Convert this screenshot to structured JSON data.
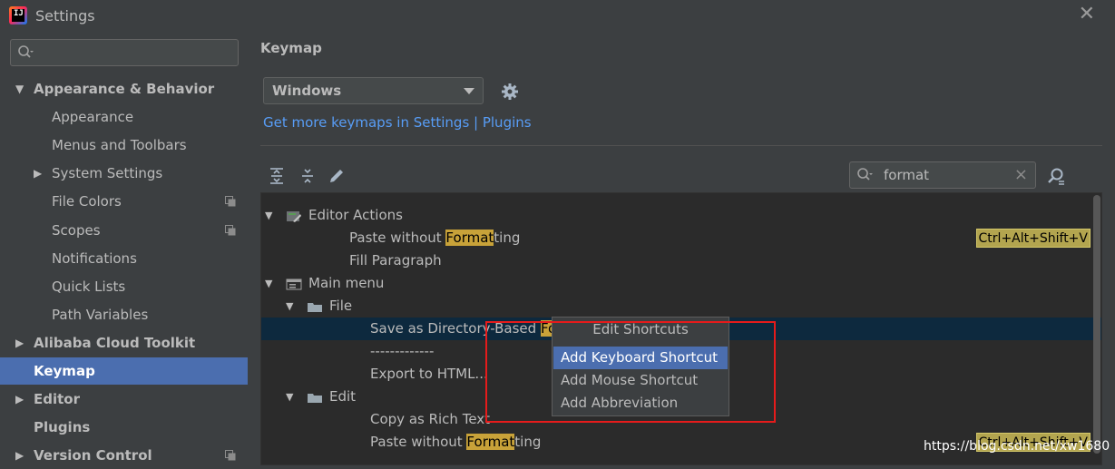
{
  "window": {
    "title": "Settings",
    "app_icon_text": "IJ"
  },
  "sidebar": {
    "search_placeholder": "",
    "items": [
      {
        "label": "Appearance & Behavior",
        "level": 0,
        "expanded": true,
        "bold": true
      },
      {
        "label": "Appearance",
        "level": 1
      },
      {
        "label": "Menus and Toolbars",
        "level": 1
      },
      {
        "label": "System Settings",
        "level": 1,
        "expanded": false
      },
      {
        "label": "File Colors",
        "level": 1,
        "copy_icon": true
      },
      {
        "label": "Scopes",
        "level": 1,
        "copy_icon": true
      },
      {
        "label": "Notifications",
        "level": 1
      },
      {
        "label": "Quick Lists",
        "level": 1
      },
      {
        "label": "Path Variables",
        "level": 1
      },
      {
        "label": "Alibaba Cloud Toolkit",
        "level": 0,
        "expanded": false,
        "bold": true
      },
      {
        "label": "Keymap",
        "level": 0,
        "bold": true,
        "selected": true
      },
      {
        "label": "Editor",
        "level": 0,
        "expanded": false,
        "bold": true
      },
      {
        "label": "Plugins",
        "level": 0,
        "bold": true
      },
      {
        "label": "Version Control",
        "level": 0,
        "expanded": false,
        "bold": true,
        "copy_icon": true
      }
    ]
  },
  "main": {
    "heading": "Keymap",
    "keymap_select": {
      "value": "Windows"
    },
    "link": "Get more keymaps in Settings | Plugins",
    "filter": {
      "value": "format"
    },
    "tree": [
      {
        "pre": "Editor Actions",
        "level": 0,
        "expander": "open",
        "icon": "editor-actions-icon"
      },
      {
        "pre": "Paste without ",
        "hl": "Format",
        "post": "ting",
        "level": 1,
        "shortcut": "Ctrl+Alt+Shift+V"
      },
      {
        "pre": "Fill Paragraph",
        "level": 1
      },
      {
        "pre": "Main menu",
        "level": 0,
        "expander": "open",
        "icon": "menu-icon"
      },
      {
        "pre": "File",
        "level": 1,
        "expander": "open",
        "icon": "folder-icon"
      },
      {
        "pre": "Save as Directory-Based ",
        "hl": "Format",
        "level": 2,
        "selected": true
      },
      {
        "pre": "-------------",
        "level": 2
      },
      {
        "pre": "Export to HTML...",
        "level": 2
      },
      {
        "pre": "Edit",
        "level": 1,
        "expander": "open",
        "icon": "folder-icon"
      },
      {
        "pre": "Copy as Rich Text",
        "level": 2
      },
      {
        "pre": "Paste without ",
        "hl": "Format",
        "post": "ting",
        "level": 2,
        "shortcut": "Ctrl+Alt+Shift+V"
      },
      {
        "pre": "-------------",
        "level": 2
      }
    ]
  },
  "popup": {
    "title": "Edit Shortcuts",
    "items": [
      "Add Keyboard Shortcut",
      "Add Mouse Shortcut",
      "Add Abbreviation"
    ],
    "active_index": 0
  },
  "watermark": "https://blog.csdn.net/xw1680",
  "colors": {
    "accent": "#4b6eaf",
    "link": "#589df6",
    "highlight": "#c8a239",
    "annotation": "#e51b1b"
  }
}
